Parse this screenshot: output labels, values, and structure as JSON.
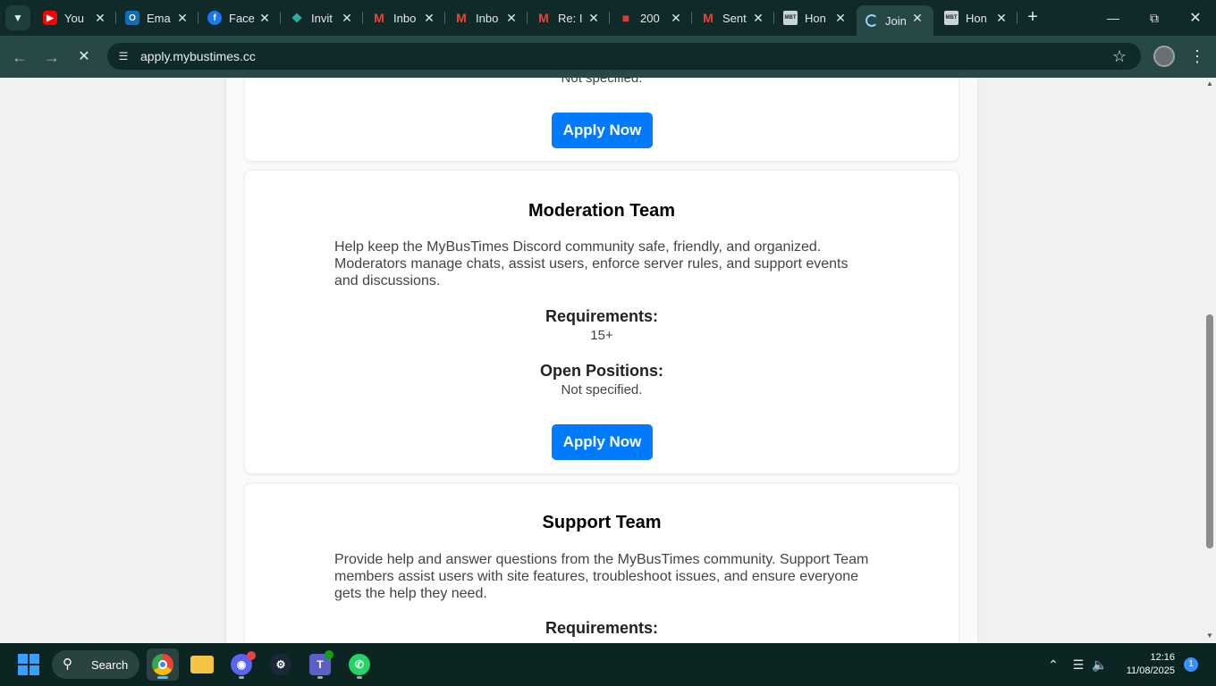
{
  "browser": {
    "tabs": [
      {
        "label": "You",
        "favicon": "youtube-icon"
      },
      {
        "label": "Ema",
        "favicon": "outlook-icon"
      },
      {
        "label": "Face",
        "favicon": "facebook-icon"
      },
      {
        "label": "Invit",
        "favicon": "invite-icon"
      },
      {
        "label": "Inbo",
        "favicon": "gmail-icon"
      },
      {
        "label": "Inbo",
        "favicon": "gmail-icon"
      },
      {
        "label": "Re: I",
        "favicon": "gmail-icon"
      },
      {
        "label": "200",
        "favicon": "red-logo-icon"
      },
      {
        "label": "Sent",
        "favicon": "gmail-icon"
      },
      {
        "label": "Hon",
        "favicon": "mybustimes-icon"
      },
      {
        "label": "Join",
        "favicon": "loading-icon",
        "active": true
      },
      {
        "label": "Hon",
        "favicon": "mybustimes-icon"
      }
    ],
    "url": "apply.mybustimes.cc"
  },
  "page": {
    "partial_card": {
      "open_positions_value": "Not specified.",
      "apply_label": "Apply Now"
    },
    "cards": [
      {
        "title": "Moderation Team",
        "description": "Help keep the MyBusTimes Discord community safe, friendly, and organized. Moderators manage chats, assist users, enforce server rules, and support events and discussions.",
        "requirements_label": "Requirements:",
        "requirements_value": "15+",
        "open_positions_label": "Open Positions:",
        "open_positions_value": "Not specified.",
        "apply_label": "Apply Now"
      },
      {
        "title": "Support Team",
        "description": "Provide help and answer questions from the MyBusTimes community. Support Team members assist users with site features, troubleshoot issues, and ensure everyone gets the help they need.",
        "requirements_label": "Requirements:"
      }
    ],
    "accent_color": "#007bff"
  },
  "taskbar": {
    "search_label": "Search",
    "time": "12:16",
    "date": "11/08/2025",
    "notification_count": "1"
  }
}
